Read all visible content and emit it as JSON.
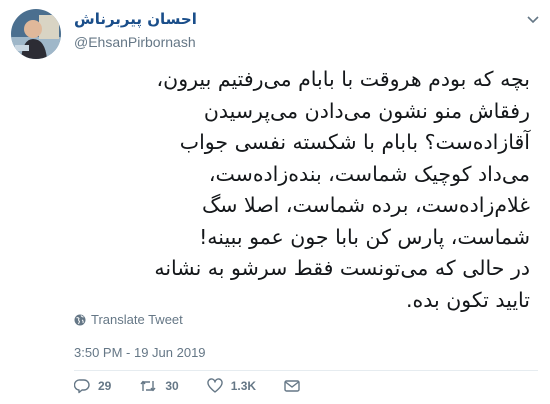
{
  "tweet": {
    "author": {
      "display_name": "احسان پیربرناش",
      "handle": "@EhsanPirbornash"
    },
    "lines": [
      "بچه که بودم هروقت با بابام می‌رفتیم بیرون،",
      "رفقاش منو نشون می‌دادن می‌پرسیدن",
      "آقازاده‌ست؟ بابام با شکسته نفسی جواب",
      "می‌داد کوچیک شماست، بنده‌زاده‌ست،",
      "غلام‌زاده‌ست، برده شماست، اصلا سگ",
      "شماست، پارس کن بابا جون عمو ببینه!",
      "در حالی که می‌تونست فقط سرشو به نشانه",
      "تایید تکون بده."
    ],
    "translate_label": "Translate Tweet",
    "timestamp": "3:50 PM - 19 Jun 2019",
    "actions": {
      "replies": "29",
      "retweets": "30",
      "likes": "1.3K"
    }
  },
  "icons": [
    "globe-icon",
    "reply-icon",
    "retweet-icon",
    "heart-icon",
    "mail-icon",
    "chevron-down-icon"
  ],
  "colors": {
    "name": "#1a4e8a",
    "secondary": "#657786",
    "text": "#14171a"
  }
}
